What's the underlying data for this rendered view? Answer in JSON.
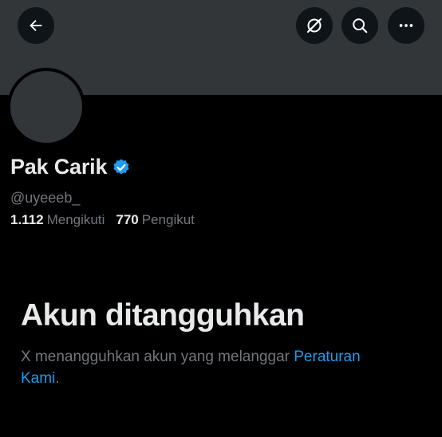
{
  "header": {
    "back_icon": "arrow-left-icon",
    "grok_icon": "grok-icon",
    "search_icon": "search-icon",
    "more_icon": "more-horizontal-icon"
  },
  "profile": {
    "display_name": "Pak Carik",
    "verified_icon": "verified-badge-icon",
    "verified_color": "#1d9bf0",
    "handle": "@uyeeeb_",
    "following_count": "1.112",
    "following_label": "Mengikuti",
    "followers_count": "770",
    "followers_label": "Pengikut"
  },
  "suspension": {
    "title": "Akun ditangguhkan",
    "description": "X menangguhkan akun yang melanggar ",
    "link_text": "Peraturan Kami",
    "trailing": "."
  },
  "colors": {
    "background": "#000000",
    "banner": "#333639",
    "primary_text": "#e7e9ea",
    "secondary_text": "#71767b",
    "link": "#1d9bf0"
  }
}
